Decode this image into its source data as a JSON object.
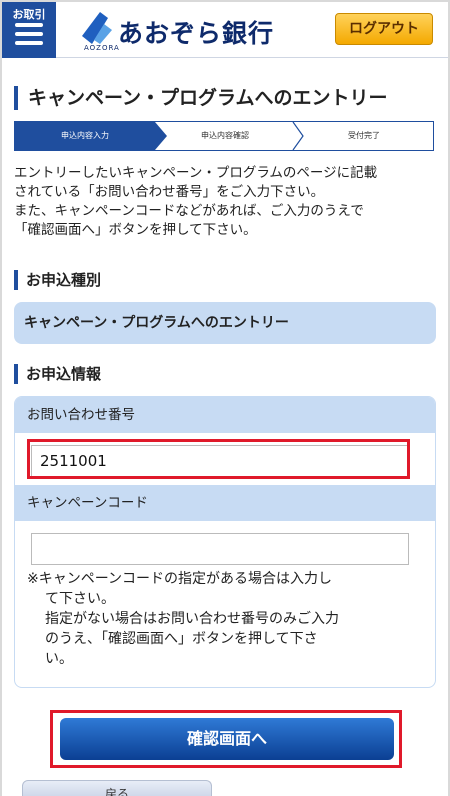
{
  "header": {
    "menu_label": "お取引",
    "bank_name": "あおぞら銀行",
    "bank_sub": "AOZORA",
    "logout_label": "ログアウト"
  },
  "page": {
    "title": "キャンペーン・プログラムへのエントリー"
  },
  "steps": [
    {
      "label": "申込内容入力",
      "active": true
    },
    {
      "label": "申込内容確認",
      "active": false
    },
    {
      "label": "受付完了",
      "active": false
    }
  ],
  "intro": [
    "エントリーしたいキャンペーン・プログラムのページに記載",
    "されている「お問い合わせ番号」をご入力下さい。",
    "また、キャンペーンコードなどがあれば、ご入力のうえで",
    "「確認画面へ」ボタンを押して下さい。"
  ],
  "application_type": {
    "heading": "お申込種別",
    "value": "キャンペーン・プログラムへのエントリー"
  },
  "application_info": {
    "heading": "お申込情報",
    "inquiry_label": "お問い合わせ番号",
    "inquiry_value": "2511001",
    "campaign_label": "キャンペーンコード",
    "campaign_value": "",
    "note_lines": [
      "※キャンペーンコードの指定がある場合は入力し",
      "て下さい。",
      "指定がない場合はお問い合わせ番号のみご入力",
      "のうえ、「確認画面へ」ボタンを押して下さ",
      "い。"
    ]
  },
  "actions": {
    "confirm_label": "確認画面へ",
    "back_label": "戻る"
  },
  "colors": {
    "brand": "#1f4e9e",
    "field_bg": "#c7dbf3",
    "highlight": "#e0192a",
    "logout_bg": "#f4a900"
  }
}
